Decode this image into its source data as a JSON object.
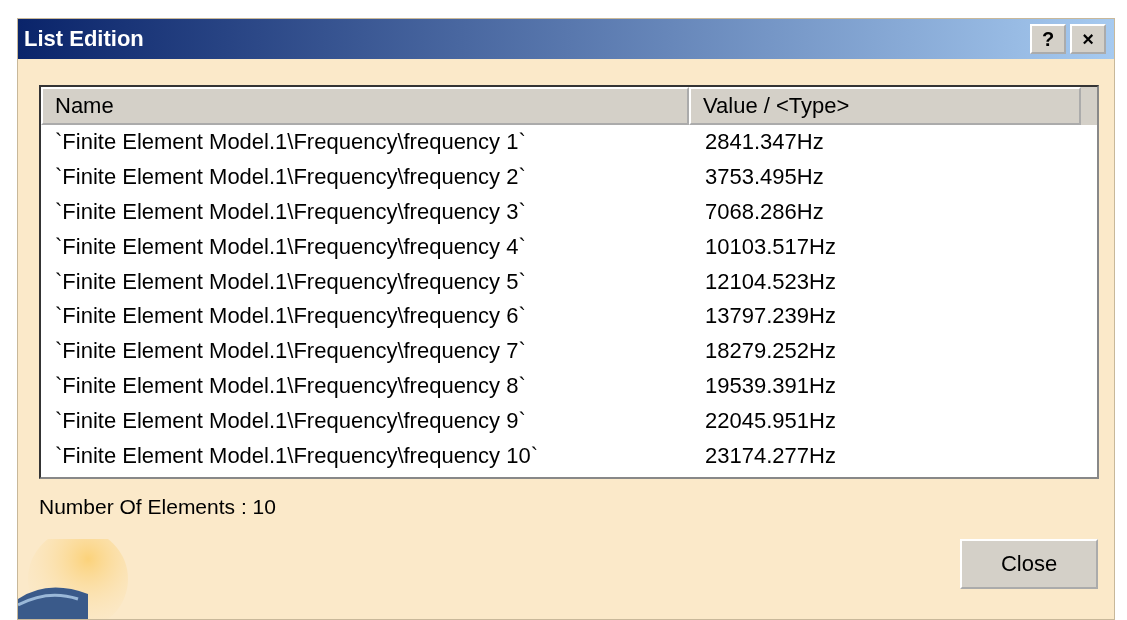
{
  "window": {
    "title": "List Edition"
  },
  "title_buttons": [
    "?",
    "×"
  ],
  "table": {
    "columns": [
      "Name",
      "Value / <Type>"
    ],
    "rows": [
      [
        "`Finite Element Model.1\\Frequency\\frequency 1`",
        "2841.347Hz"
      ],
      [
        "`Finite Element Model.1\\Frequency\\frequency 2`",
        "3753.495Hz"
      ],
      [
        "`Finite Element Model.1\\Frequency\\frequency 3`",
        "7068.286Hz"
      ],
      [
        "`Finite Element Model.1\\Frequency\\frequency 4`",
        "10103.517Hz"
      ],
      [
        "`Finite Element Model.1\\Frequency\\frequency 5`",
        "12104.523Hz"
      ],
      [
        "`Finite Element Model.1\\Frequency\\frequency 6`",
        "13797.239Hz"
      ],
      [
        "`Finite Element Model.1\\Frequency\\frequency 7`",
        "18279.252Hz"
      ],
      [
        "`Finite Element Model.1\\Frequency\\frequency 8`",
        "19539.391Hz"
      ],
      [
        "`Finite Element Model.1\\Frequency\\frequency 9`",
        "22045.951Hz"
      ],
      [
        "`Finite Element Model.1\\Frequency\\frequency 10`",
        "23174.277Hz"
      ]
    ]
  },
  "status": "Number Of Elements : 10",
  "buttons": [
    "Close"
  ]
}
